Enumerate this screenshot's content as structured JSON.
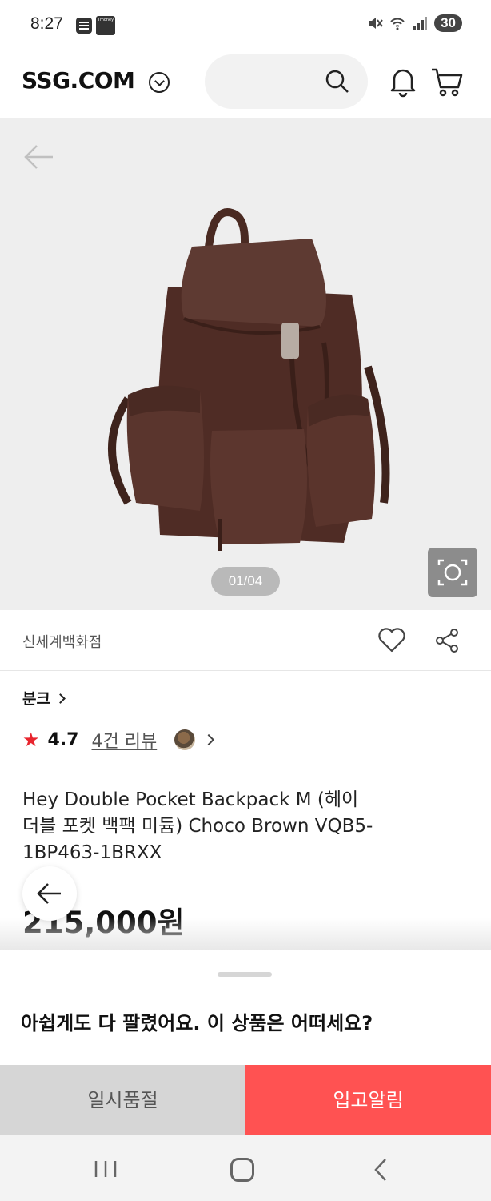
{
  "status_bar": {
    "time": "8:27",
    "battery": "30",
    "app_badge_text": "Tmoney"
  },
  "header": {
    "logo": "SSG.COM",
    "search_placeholder": ""
  },
  "gallery": {
    "counter": "01/04"
  },
  "seller": {
    "name": "신세계백화점"
  },
  "product": {
    "brand": "분크",
    "rating": "4.7",
    "review_link": "4건 리뷰",
    "title": "Hey Double Pocket Backpack M (헤이 더블 포켓 백팩 미듐) Choco Brown VQB5-1BP463-1BRXX",
    "price": "215,000원"
  },
  "sheet": {
    "title": "아쉽게도 다 팔렸어요. 이 상품은 어떠세요?"
  },
  "buttons": {
    "soldout": "일시품절",
    "notify": "입고알림"
  },
  "colors": {
    "accent_red": "#ff5252",
    "star_red": "#e8252e",
    "soldout_gray": "#d6d6d6"
  },
  "icons": [
    "search-icon",
    "bell-icon",
    "cart-icon",
    "back-arrow-icon",
    "camera-lens-icon",
    "heart-icon",
    "share-icon",
    "star-icon"
  ]
}
